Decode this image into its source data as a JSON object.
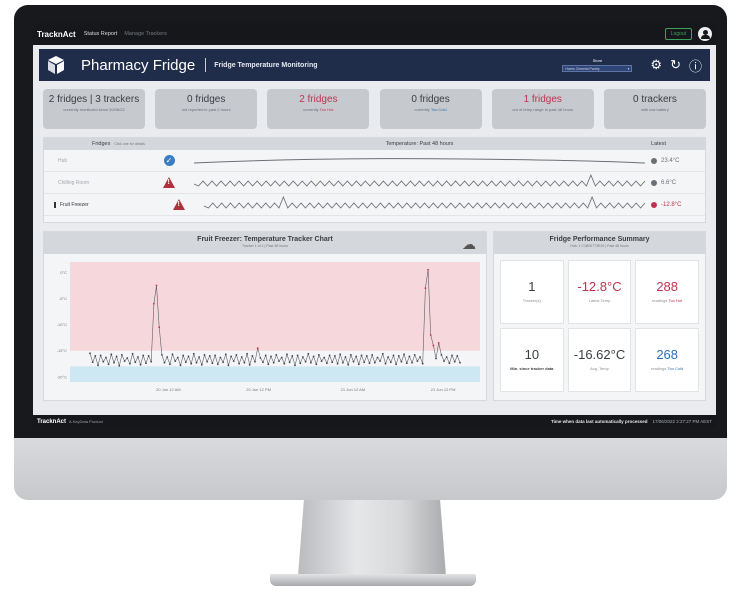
{
  "topbar": {
    "brand": "TracknAct",
    "nav": [
      "Status Report",
      "Manage Trackers"
    ],
    "logout": "Logout"
  },
  "header": {
    "title": "Pharmacy Fridge",
    "subtitle": "Fridge Temperature Monitoring",
    "store_label": "Store",
    "store_value": "Harris Chemist Pantry"
  },
  "kpis": [
    {
      "main": "2 fridges | 3 trackers",
      "sub": "currently monitored since 20/06/22"
    },
    {
      "main": "0 fridges",
      "sub": "not reported in past 2 hours"
    },
    {
      "main": "2 fridges",
      "sub_prefix": "currently",
      "sub_flag": "Too Hot"
    },
    {
      "main": "0 fridges",
      "sub_prefix": "currently",
      "sub_flag": "Too Cold"
    },
    {
      "main": "1 fridges",
      "sub": "out of temp range in past 48 hours"
    },
    {
      "main": "0 trackers",
      "sub": "with low battery"
    }
  ],
  "fridges": {
    "col_fridges": "Fridges",
    "col_hint": "Click one for details",
    "col_temp": "Temperature: Past 48 hours",
    "col_latest": "Latest",
    "rows": [
      {
        "name": "Hub",
        "status": "ok",
        "latest": "23.4°C"
      },
      {
        "name": "Chilling Room",
        "status": "warn",
        "latest": "6.6°C"
      },
      {
        "name": "Fruit Freezer",
        "status": "warn",
        "latest": "-12.8°C"
      }
    ]
  },
  "chart_panel": {
    "title": "Fruit Freezer: Temperature Tracker Chart",
    "subtitle": "Tracker 1 of 1 | Past 48 hours"
  },
  "chart_data": {
    "type": "line",
    "x_ticks": [
      "20 Jun 12 AM",
      "20 Jun 12 PM",
      "21 Jun 12 AM",
      "21 Jun 12 PM"
    ],
    "y_ticks": [
      "0°C",
      "-5°C",
      "-10°C",
      "-15°C",
      "-20°C"
    ],
    "ylim": [
      -21,
      2
    ],
    "bands": {
      "hot_above": -15,
      "cold_below": -18
    },
    "series": [
      {
        "values": [
          -15.5,
          -17.2,
          -16.0,
          -17.8,
          -15.9,
          -17.1,
          -16.3,
          -17.6,
          -15.7,
          -17.3,
          -16.1,
          -17.9,
          -15.8,
          -17.0,
          -16.4,
          -17.5,
          -15.6,
          -17.2,
          -16.2,
          -17.7,
          -15.9,
          -17.4,
          -16.0,
          -17.1,
          -6.0,
          -2.5,
          -10.5,
          -15.8,
          -17.3,
          -16.2,
          -17.6,
          -15.7,
          -17.0,
          -16.3,
          -17.8,
          -15.9,
          -17.2,
          -16.1,
          -17.5,
          -15.6,
          -17.3,
          -16.2,
          -17.7,
          -15.8,
          -17.1,
          -16.0,
          -17.4,
          -15.9,
          -17.6,
          -16.3,
          -17.2,
          -15.7,
          -17.8,
          -16.1,
          -17.0,
          -15.8,
          -17.5,
          -16.2,
          -17.3,
          -15.6,
          -17.7,
          -16.0,
          -17.1,
          -14.5,
          -16.4,
          -17.2,
          -15.9,
          -17.6,
          -16.1,
          -17.3,
          -15.8,
          -17.0,
          -16.3,
          -17.5,
          -15.7,
          -17.2,
          -16.0,
          -17.8,
          -15.9,
          -17.4,
          -16.2,
          -17.1,
          -15.6,
          -17.3,
          -16.1,
          -17.6,
          -15.8,
          -17.0,
          -16.3,
          -17.4,
          -15.9,
          -17.2,
          -16.0,
          -17.5,
          -15.7,
          -17.3,
          -16.2,
          -17.7,
          -15.8,
          -17.1,
          -16.1,
          -17.6,
          -15.9,
          -17.2,
          -16.0,
          -17.4,
          -15.8,
          -17.3,
          -16.3,
          -17.0,
          -15.6,
          -17.5,
          -16.2,
          -17.2,
          -15.9,
          -17.6,
          -16.0,
          -17.1,
          -15.7,
          -17.4,
          -16.1,
          -17.3,
          -15.8,
          -17.0,
          -16.2,
          -17.5,
          -3.0,
          0.5,
          -12.0,
          -14.0,
          -16.5,
          -13.5,
          -15.8,
          -17.0,
          -16.2,
          -17.4,
          -15.9,
          -17.1,
          -16.0,
          -17.3
        ]
      }
    ]
  },
  "summary": {
    "title": "Fridge Performance Summary",
    "subtitle": "Hub: 1 C1B00773E29 | Past 48 hours",
    "cells": [
      {
        "value": "1",
        "label": "Tracker(s)"
      },
      {
        "value": "-12.8°C",
        "label": "Latest Temp"
      },
      {
        "value": "288",
        "label_prefix": "readings",
        "label_flag": "Too Hot"
      },
      {
        "value": "10",
        "label": "Min. since tracker data"
      },
      {
        "value": "-16.62°C",
        "label": "Avg. Temp"
      },
      {
        "value": "268",
        "label_prefix": "readings",
        "label_flag": "Too Cold"
      }
    ]
  },
  "footer": {
    "brand": "TracknAct",
    "tagline": "A KeyData Product",
    "processed": "Time when data last automatically processed",
    "time": "17/06/2022 2:27:27 PM AEST"
  },
  "colors": {
    "navy": "#1f2d4b",
    "hot": "#c0334f",
    "cold": "#2e6fb0",
    "hot_band": "#f6d7db",
    "cold_band": "#cde8f3"
  }
}
